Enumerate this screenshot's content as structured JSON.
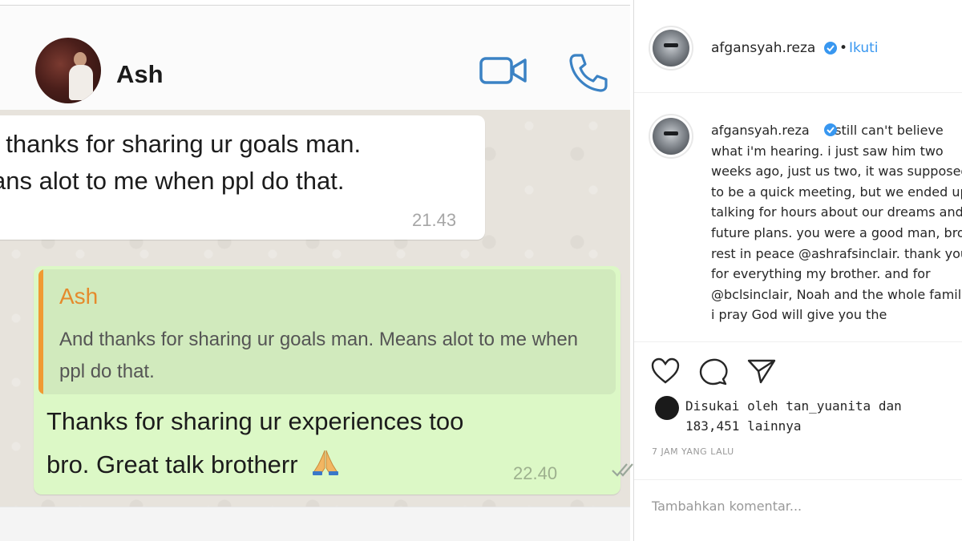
{
  "chat": {
    "contact_name": "Ash",
    "icons": {
      "video": "video-call-icon",
      "phone": "phone-icon",
      "emoji": "folded-hands-emoji",
      "ticks": "double-check-icon"
    },
    "incoming": {
      "lines": [
        "I thanks for sharing ur goals man.",
        "ans alot to me when ppl do that."
      ],
      "time": "21.43"
    },
    "outgoing": {
      "quote_name": "Ash",
      "quote_text": "And thanks for sharing ur goals man. Means alot to me when ppl do that.",
      "lines": [
        "Thanks for sharing ur experiences too",
        "bro. Great talk brotherr"
      ],
      "time": "22.40"
    },
    "colors": {
      "accent_blue": "#3b82c4",
      "quote_orange": "#f09a33",
      "bubble_out": "#dcf8c6"
    }
  },
  "instagram": {
    "username": "afgansyah.reza",
    "separator": "•",
    "follow_label": "Ikuti",
    "caption": "i still can't believe what i'm hearing. i just saw him two weeks ago, just us two, it was supposed to be a quick meeting, but we ended up talking for hours about our dreams and future plans. you were a good man, bro. rest in peace @ashrafsinclair. thank you for everything my brother. and for @bclsinclair, Noah and the whole family, i pray God will give you the",
    "actions": [
      "heart-icon",
      "comment-icon",
      "share-icon"
    ],
    "liked_by_line1": "Disukai oleh tan_yuanita dan",
    "liked_by_line2": "183,451 lainnya",
    "time_ago": "7 JAM YANG LALU",
    "comment_placeholder": "Tambahkan komentar...",
    "colors": {
      "link_blue": "#3897f0",
      "verified_blue": "#3897f0"
    }
  }
}
